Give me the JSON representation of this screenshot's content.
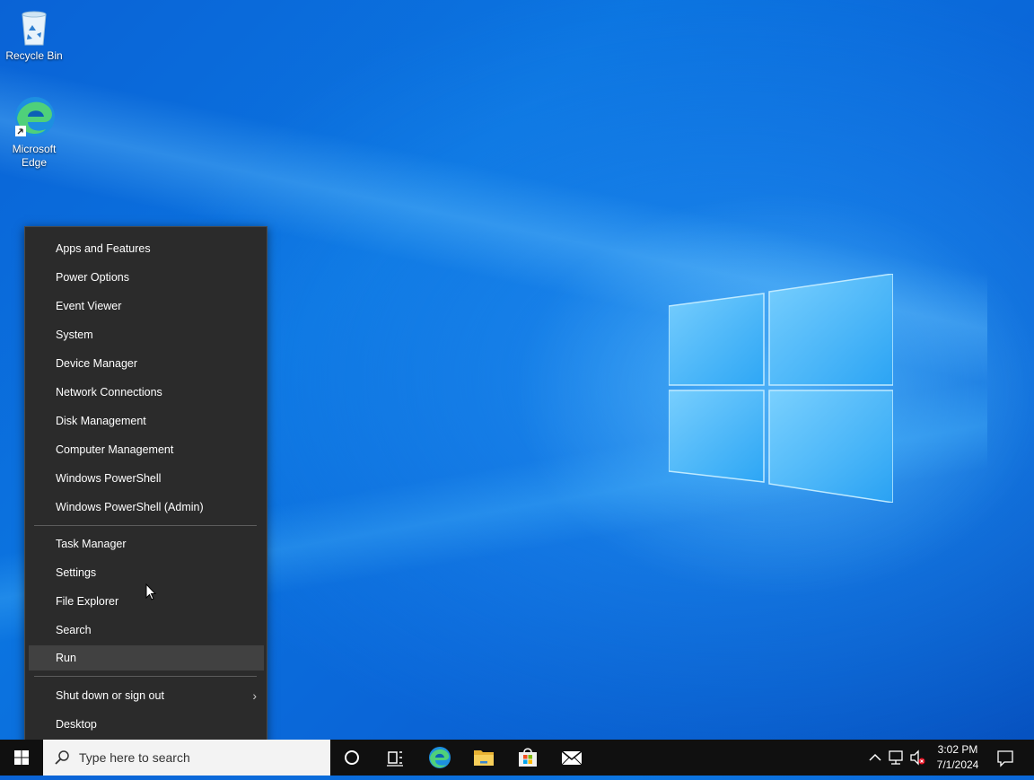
{
  "desktop": {
    "icons": [
      {
        "label": "Recycle Bin",
        "icon": "recycle-bin-icon"
      },
      {
        "label": "Microsoft Edge",
        "icon": "edge-icon"
      }
    ]
  },
  "context_menu": {
    "items": [
      "Apps and Features",
      "Power Options",
      "Event Viewer",
      "System",
      "Device Manager",
      "Network Connections",
      "Disk Management",
      "Computer Management",
      "Windows PowerShell",
      "Windows PowerShell (Admin)",
      "Task Manager",
      "Settings",
      "File Explorer",
      "Search",
      "Run",
      "Shut down or sign out",
      "Desktop"
    ],
    "highlighted": "Run"
  },
  "taskbar": {
    "search_placeholder": "Type here to search",
    "time": "3:02 PM",
    "date": "7/1/2024",
    "pinned": [
      "cortana-icon",
      "task-view-icon",
      "edge-icon",
      "file-explorer-icon",
      "store-icon",
      "mail-icon"
    ]
  },
  "colors": {
    "menu_bg": "#2b2b2b",
    "menu_hover": "#414141",
    "taskbar_bg": "#101010",
    "accent": "#0a74e0"
  }
}
